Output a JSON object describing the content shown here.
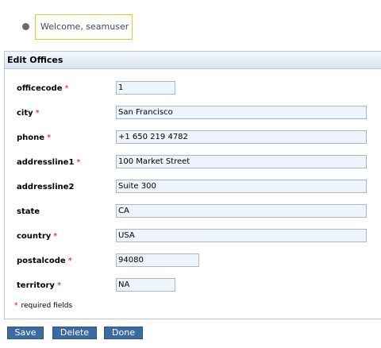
{
  "welcome": {
    "text": "Welcome, seamuser"
  },
  "panel": {
    "title": "Edit Offices"
  },
  "fields": [
    {
      "label": "officecode",
      "required": "*",
      "value": "1"
    },
    {
      "label": "city",
      "required": "*",
      "value": "San Francisco"
    },
    {
      "label": "phone",
      "required": "*",
      "value": "+1 650 219 4782"
    },
    {
      "label": "addressline1",
      "required": "*",
      "value": "100 Market Street"
    },
    {
      "label": "addressline2",
      "required": "",
      "value": "Suite 300"
    },
    {
      "label": "state",
      "required": "",
      "value": "CA"
    },
    {
      "label": "country",
      "required": "*",
      "value": "USA"
    },
    {
      "label": "postalcode",
      "required": "*",
      "value": "94080"
    },
    {
      "label": "territory",
      "required": "*",
      "value": "NA"
    }
  ],
  "note": {
    "star": "*",
    "text": "required fields"
  },
  "buttons": {
    "save": "Save",
    "delete": "Delete",
    "done": "Done"
  },
  "colors": {
    "button_bg": "#3c6aa3",
    "field_bg": "#eef4fb",
    "welcome_border": "#e8c540",
    "required": "#ee0000"
  }
}
